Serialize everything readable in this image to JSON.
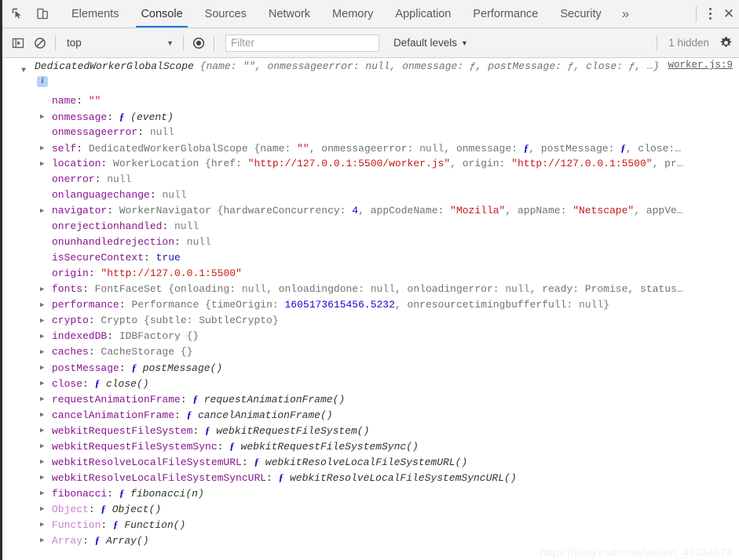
{
  "tabbar": {
    "icons": [
      {
        "name": "inspect-element-icon",
        "glyph": "cursor-box"
      },
      {
        "name": "device-toolbar-icon",
        "glyph": "device"
      }
    ],
    "tabs": [
      {
        "label": "Elements",
        "active": false
      },
      {
        "label": "Console",
        "active": true
      },
      {
        "label": "Sources",
        "active": false
      },
      {
        "label": "Network",
        "active": false
      },
      {
        "label": "Memory",
        "active": false
      },
      {
        "label": "Application",
        "active": false
      },
      {
        "label": "Performance",
        "active": false
      },
      {
        "label": "Security",
        "active": false
      }
    ],
    "more_label": "»",
    "close_label": "✕",
    "accent_color": "#1a73e8"
  },
  "filterbar": {
    "execute_icon": "console-sidebar-icon",
    "clear_icon": "clear-console-icon",
    "context": "top",
    "caret": "▼",
    "eye_icon": "live-expression-icon",
    "filter_placeholder": "Filter",
    "filter_value": "",
    "levels_label": "Default levels",
    "hidden_label": "1 hidden",
    "gear_icon": "settings-gear-icon"
  },
  "console": {
    "source_link": "worker.js:9",
    "info_badge": "i",
    "header": {
      "class": "DedicatedWorkerGlobalScope",
      "preview": " {name: \"\", onmessageerror: null, onmessage: ƒ, postMessage: ƒ, close: ƒ, …}"
    },
    "properties": [
      {
        "expandable": false,
        "key": "name",
        "dim": false,
        "value": "\"\"",
        "vtype": "str"
      },
      {
        "expandable": true,
        "key": "onmessage",
        "dim": false,
        "value": "ƒ (event)",
        "vtype": "fn"
      },
      {
        "expandable": false,
        "key": "onmessageerror",
        "dim": false,
        "value": "null",
        "vtype": "null"
      },
      {
        "expandable": true,
        "key": "self",
        "dim": false,
        "value": "DedicatedWorkerGlobalScope {name: \"\", onmessageerror: null, onmessage: ƒ, postMessage: ƒ, close:…",
        "vtype": "obj"
      },
      {
        "expandable": true,
        "key": "location",
        "dim": false,
        "value": "WorkerLocation {href: \"http://127.0.0.1:5500/worker.js\", origin: \"http://127.0.0.1:5500\", pr…",
        "vtype": "obj"
      },
      {
        "expandable": false,
        "key": "onerror",
        "dim": false,
        "value": "null",
        "vtype": "null"
      },
      {
        "expandable": false,
        "key": "onlanguagechange",
        "dim": false,
        "value": "null",
        "vtype": "null"
      },
      {
        "expandable": true,
        "key": "navigator",
        "dim": false,
        "value": "WorkerNavigator {hardwareConcurrency: 4, appCodeName: \"Mozilla\", appName: \"Netscape\", appVe…",
        "vtype": "obj"
      },
      {
        "expandable": false,
        "key": "onrejectionhandled",
        "dim": false,
        "value": "null",
        "vtype": "null"
      },
      {
        "expandable": false,
        "key": "onunhandledrejection",
        "dim": false,
        "value": "null",
        "vtype": "null"
      },
      {
        "expandable": false,
        "key": "isSecureContext",
        "dim": false,
        "value": "true",
        "vtype": "bool"
      },
      {
        "expandable": false,
        "key": "origin",
        "dim": false,
        "value": "\"http://127.0.0.1:5500\"",
        "vtype": "str"
      },
      {
        "expandable": true,
        "key": "fonts",
        "dim": false,
        "value": "FontFaceSet {onloading: null, onloadingdone: null, onloadingerror: null, ready: Promise, status…",
        "vtype": "obj"
      },
      {
        "expandable": true,
        "key": "performance",
        "dim": false,
        "value": "Performance {timeOrigin: 1605173615456.5232, onresourcetimingbufferfull: null}",
        "vtype": "obj"
      },
      {
        "expandable": true,
        "key": "crypto",
        "dim": false,
        "value": "Crypto {subtle: SubtleCrypto}",
        "vtype": "obj"
      },
      {
        "expandable": true,
        "key": "indexedDB",
        "dim": false,
        "value": "IDBFactory {}",
        "vtype": "obj"
      },
      {
        "expandable": true,
        "key": "caches",
        "dim": false,
        "value": "CacheStorage {}",
        "vtype": "obj"
      },
      {
        "expandable": true,
        "key": "postMessage",
        "dim": false,
        "value": "ƒ postMessage()",
        "vtype": "fn"
      },
      {
        "expandable": true,
        "key": "close",
        "dim": false,
        "value": "ƒ close()",
        "vtype": "fn"
      },
      {
        "expandable": true,
        "key": "requestAnimationFrame",
        "dim": false,
        "value": "ƒ requestAnimationFrame()",
        "vtype": "fn"
      },
      {
        "expandable": true,
        "key": "cancelAnimationFrame",
        "dim": false,
        "value": "ƒ cancelAnimationFrame()",
        "vtype": "fn"
      },
      {
        "expandable": true,
        "key": "webkitRequestFileSystem",
        "dim": false,
        "value": "ƒ webkitRequestFileSystem()",
        "vtype": "fn"
      },
      {
        "expandable": true,
        "key": "webkitRequestFileSystemSync",
        "dim": false,
        "value": "ƒ webkitRequestFileSystemSync()",
        "vtype": "fn"
      },
      {
        "expandable": true,
        "key": "webkitResolveLocalFileSystemURL",
        "dim": false,
        "value": "ƒ webkitResolveLocalFileSystemURL()",
        "vtype": "fn"
      },
      {
        "expandable": true,
        "key": "webkitResolveLocalFileSystemSyncURL",
        "dim": false,
        "value": "ƒ webkitResolveLocalFileSystemSyncURL()",
        "vtype": "fn"
      },
      {
        "expandable": true,
        "key": "fibonacci",
        "dim": false,
        "value": "ƒ fibonacci(n)",
        "vtype": "fn"
      },
      {
        "expandable": true,
        "key": "Object",
        "dim": true,
        "value": "ƒ Object()",
        "vtype": "fn"
      },
      {
        "expandable": true,
        "key": "Function",
        "dim": true,
        "value": "ƒ Function()",
        "vtype": "fn"
      },
      {
        "expandable": true,
        "key": "Array",
        "dim": true,
        "value": "ƒ Array()",
        "vtype": "fn"
      }
    ]
  },
  "watermark": "https://blog.csdn.net/weixin_43334673"
}
